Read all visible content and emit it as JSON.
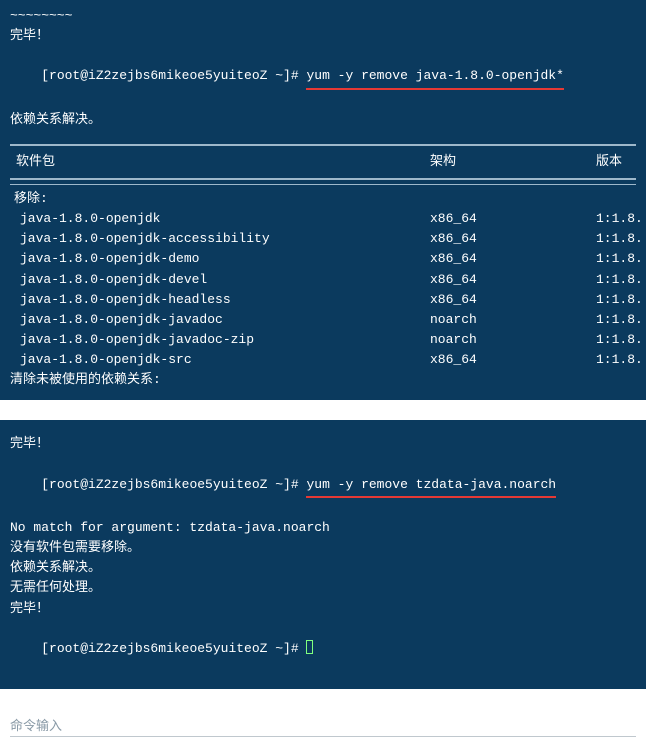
{
  "terminal1": {
    "garbled_top": "~~~~~~~~",
    "done": "完毕！",
    "prompt_prefix": "[root@iZ2zejbs6mikeoe5yuiteoZ ~]# ",
    "command": "yum -y remove java-1.8.0-openjdk*",
    "deps": "依赖关系解决。",
    "headers": {
      "pkg": "软件包",
      "arch": "架构",
      "ver": "版本"
    },
    "remove_label": "移除:",
    "rows": [
      {
        "pkg": "java-1.8.0-openjdk",
        "arch": "x86_64",
        "ver": "1:1.8."
      },
      {
        "pkg": "java-1.8.0-openjdk-accessibility",
        "arch": "x86_64",
        "ver": "1:1.8."
      },
      {
        "pkg": "java-1.8.0-openjdk-demo",
        "arch": "x86_64",
        "ver": "1:1.8."
      },
      {
        "pkg": "java-1.8.0-openjdk-devel",
        "arch": "x86_64",
        "ver": "1:1.8."
      },
      {
        "pkg": "java-1.8.0-openjdk-headless",
        "arch": "x86_64",
        "ver": "1:1.8."
      },
      {
        "pkg": "java-1.8.0-openjdk-javadoc",
        "arch": "noarch",
        "ver": "1:1.8."
      },
      {
        "pkg": "java-1.8.0-openjdk-javadoc-zip",
        "arch": "noarch",
        "ver": "1:1.8."
      },
      {
        "pkg": "java-1.8.0-openjdk-src",
        "arch": "x86_64",
        "ver": "1:1.8."
      }
    ],
    "cleanup": "清除未被使用的依赖关系:"
  },
  "terminal2": {
    "done": "完毕！",
    "prompt_prefix": "[root@iZ2zejbs6mikeoe5yuiteoZ ~]# ",
    "command": "yum -y remove tzdata-java.noarch",
    "no_match": "No match for argument: tzdata-java.noarch",
    "no_pkg": "没有软件包需要移除。",
    "deps": "依赖关系解决。",
    "nothing": "无需任何处理。",
    "done2": "完毕！",
    "prompt2": "[root@iZ2zejbs6mikeoe5yuiteoZ ~]# "
  },
  "footer": {
    "input_label": "命令输入"
  }
}
